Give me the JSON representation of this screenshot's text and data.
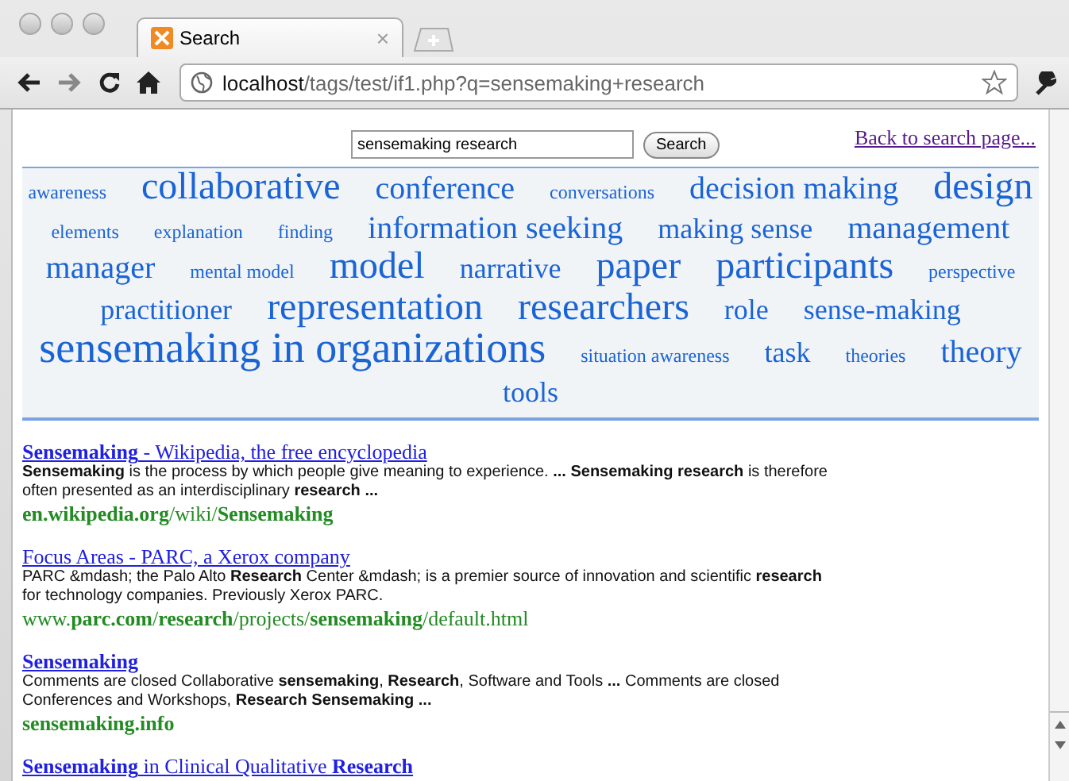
{
  "tab": {
    "title": "Search",
    "close": "×"
  },
  "address": {
    "host": "localhost",
    "path": "/tags/test/if1.php?q=sensemaking+research"
  },
  "search": {
    "value": "sensemaking research",
    "button": "Search",
    "back_link": "Back to search page..."
  },
  "tag_cloud": [
    {
      "label": "awareness",
      "kind": "xs"
    },
    {
      "label": "collaborative",
      "kind": "xl"
    },
    {
      "label": "conference",
      "kind": "l"
    },
    {
      "label": "conversations",
      "kind": "xs"
    },
    {
      "label": "decision making",
      "kind": "l"
    },
    {
      "label": "design",
      "kind": "xl"
    },
    {
      "label": "elements",
      "kind": "xs"
    },
    {
      "label": "explanation",
      "kind": "xs"
    },
    {
      "label": "finding",
      "kind": "xs"
    },
    {
      "label": "information seeking",
      "kind": "l"
    },
    {
      "label": "making sense",
      "kind": "m"
    },
    {
      "label": "management",
      "kind": "l"
    },
    {
      "label": "manager",
      "kind": "l"
    },
    {
      "label": "mental model",
      "kind": "xs"
    },
    {
      "label": "model",
      "kind": "xl"
    },
    {
      "label": "narrative",
      "kind": "m"
    },
    {
      "label": "paper",
      "kind": "xl"
    },
    {
      "label": "participants",
      "kind": "xl"
    },
    {
      "label": "perspective",
      "kind": "xs"
    },
    {
      "label": "practitioner",
      "kind": "m"
    },
    {
      "label": "representation",
      "kind": "xl"
    },
    {
      "label": "researchers",
      "kind": "xl"
    },
    {
      "label": "role",
      "kind": "m"
    },
    {
      "label": "sense-making",
      "kind": "m"
    },
    {
      "label": "sensemaking in organizations",
      "kind": "xxl"
    },
    {
      "label": "situation awareness",
      "kind": "xs"
    },
    {
      "label": "task",
      "kind": "m"
    },
    {
      "label": "theories",
      "kind": "xs"
    },
    {
      "label": "theory",
      "kind": "l"
    },
    {
      "label": "tools",
      "kind": "m"
    }
  ],
  "results": [
    {
      "title": "**Sensemaking** - Wikipedia, the free encyclopedia",
      "snippet": "**Sensemaking** is the process by which people give meaning to experience. **...** **Sensemaking research** is therefore often presented as an interdisciplinary **research ...**",
      "url": "**en.wikipedia.org**/wiki/**Sensemaking**"
    },
    {
      "title": "Focus Areas - PARC, a Xerox company",
      "snippet": "PARC &mdash; the Palo Alto **Research** Center &mdash; is a premier source of innovation and scientific **research** for technology companies. Previously Xerox PARC.",
      "url": "www.**parc.com**/**research**/projects/**sensemaking**/default.html"
    },
    {
      "title": "**Sensemaking**",
      "snippet": "Comments are closed Collaborative **sensemaking**, **Research**, Software and Tools **...** Comments are closed Conferences and Workshops, **Research Sensemaking ...**",
      "url": "**sensemaking.info**"
    },
    {
      "title": "**Sensemaking** in Clinical Qualitative **Research**"
    }
  ]
}
